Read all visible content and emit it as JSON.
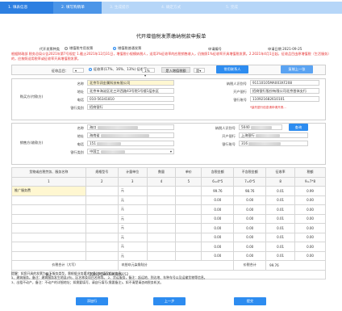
{
  "steps": [
    "1. 填表信息",
    "2. 填写购销单",
    "3. 生成提示",
    "4. 确定方式",
    "5. 完成"
  ],
  "form_title": "代开增值税发票缴纳税款申报单",
  "invoice_type_label": "代开发票种类",
  "invoice_types": [
    "增值税专用发票",
    "增值税普通发票"
  ],
  "applicant_label": "申请编号",
  "apply_date": "申请日期  2021-09-25",
  "notice": "根据财政部 税务总局公告2021年第7号规定 1.截止2021年12月31日，增值税小规模纳税人，适用3%征收率的应税销售收入，仍按照1%征收率开具增值税发票。2.2021年4月1日起，征收品目由原增值税（生活服务）的，应按照适用税率或征收率开具增值税发票。",
  "levy_rate_label": "征收品目：",
  "levy_rate_value": "",
  "rate_label": "征收率(17%、16%、13%) 征收率：",
  "rate_value": "1%",
  "calc_method_label": "是入增值税额",
  "calc_method_value": "是",
  "btn_add_contact": "常用联系人",
  "btn_prev": "复制上一张",
  "seller_section": "购买方(付款方)",
  "seller": {
    "name_label": "名称",
    "name": "北京华润金属科技有限公司",
    "taxid_label": "纳税人识别号",
    "taxid": "91110105MA003XF208",
    "address_label": "地址",
    "address": "北京市海淀区北三环西路43号院1号楼1层东区",
    "bank_label": "开户银行",
    "bank": "招商银行股份有限公司北京首体支行",
    "phone_label": "电话",
    "phone": "010-56341810",
    "account_label": "银行账号",
    "account": "110921682610101",
    "bank2_label": "银行类别",
    "bank2": "招商银行",
    "hint": "*缺失银行信息请申请开具..."
  },
  "buyer_section": "销售方(收款方)",
  "buyer": {
    "name_label": "名称",
    "name": "海口",
    "taxid_label": "纳税人识别号",
    "taxid": "5040",
    "address_label": "地址",
    "address": "海南省",
    "bank_label": "开户银行",
    "bank": "上海银行",
    "phone_label": "电话",
    "phone": "151",
    "account_label": "银行账号",
    "account": "316",
    "bank2_label": "银行类别",
    "bank2": "中国工",
    "btn_query": "查询"
  },
  "table": {
    "headers": [
      "货物或应税劳务、服务名称",
      "规格型号",
      "计量单位",
      "数量",
      "单价",
      "含税金额",
      "不含税金额",
      "征收率",
      "税额"
    ],
    "formula": [
      "1",
      "2",
      "3",
      "4",
      "5",
      "6=4*5",
      "7=6*5",
      "8",
      "9=7*8"
    ],
    "rows": [
      {
        "name": "推广服务费",
        "unit": "元",
        "qty": "",
        "price": "",
        "amount": "99.76",
        "net": "98.76",
        "rate": "0.01",
        "tax": "0.99"
      },
      {
        "name": "",
        "unit": "元",
        "qty": "",
        "price": "",
        "amount": "0.00",
        "net": "0.00",
        "rate": "0.01",
        "tax": "0.00"
      },
      {
        "name": "",
        "unit": "元",
        "qty": "",
        "price": "",
        "amount": "0.00",
        "net": "0.00",
        "rate": "0.01",
        "tax": "0.00"
      },
      {
        "name": "",
        "unit": "元",
        "qty": "",
        "price": "",
        "amount": "0.00",
        "net": "0.00",
        "rate": "0.01",
        "tax": "0.00"
      },
      {
        "name": "",
        "unit": "元",
        "qty": "",
        "price": "",
        "amount": "0.00",
        "net": "0.00",
        "rate": "0.01",
        "tax": "0.00"
      },
      {
        "name": "",
        "unit": "元",
        "qty": "",
        "price": "",
        "amount": "0.00",
        "net": "0.00",
        "rate": "0.01",
        "tax": "0.00"
      },
      {
        "name": "",
        "unit": "元",
        "qty": "",
        "price": "",
        "amount": "0.00",
        "net": "0.00",
        "rate": "0.01",
        "tax": "0.00"
      },
      {
        "name": "",
        "unit": "元",
        "qty": "",
        "price": "",
        "amount": "0.00",
        "net": "0.00",
        "rate": "0.01",
        "tax": "0.00"
      }
    ],
    "total_cap_label": "价税合计（大写）",
    "total_cap": "玖拾玖元柒角陆分",
    "total_label": "价税合计",
    "total": "99.76",
    "remark_label": "备注",
    "remark": "2021045001000000152"
  },
  "footnote_1": "提醒：如您开具的发票为以下服务类型，需根据业务要求在备注栏填写相关信息。",
  "footnote_2": "1、建筑服务，备注：建筑服务发生地县(市)、区名称及项目名称等。 2、货运服务，备注：起运地、到达地、车种车号以及运输货物等信息。",
  "footnote_3": "3、出租不动产，备注：不动产的详细地址；如需要填写，请自行填写(需要备注)，如不清楚请咨询税务机关。",
  "btn_save": "添加行",
  "btn_back": "上一步",
  "btn_submit": "提交"
}
